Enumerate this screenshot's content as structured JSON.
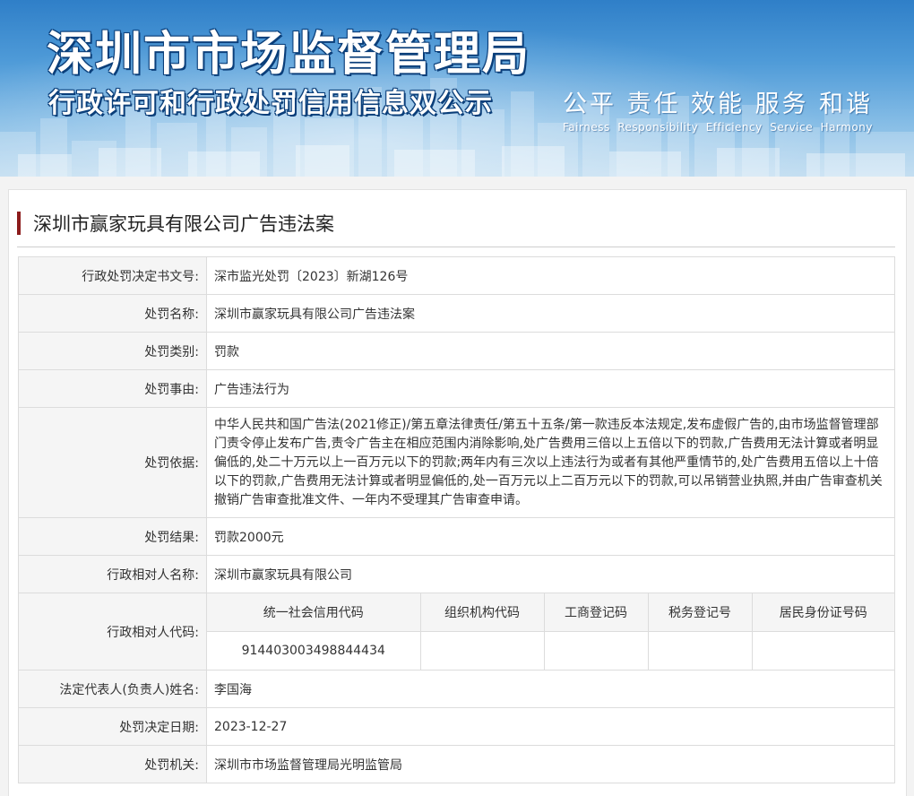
{
  "banner": {
    "title": "深圳市市场监督管理局",
    "subtitle": "行政许可和行政处罚信用信息双公示",
    "slogans_cn": [
      "公平",
      "责任",
      "效能",
      "服务",
      "和谐"
    ],
    "slogans_en": [
      "Fairness",
      "Responsibility",
      "Efficiency",
      "Service",
      "Harmony"
    ]
  },
  "page": {
    "heading": "深圳市赢家玩具有限公司广告违法案"
  },
  "record": {
    "doc_no": {
      "label": "行政处罚决定书文号:",
      "value": "深市监光处罚〔2023〕新湖126号"
    },
    "case_name": {
      "label": "处罚名称:",
      "value": "深圳市赢家玩具有限公司广告违法案"
    },
    "category": {
      "label": "处罚类别:",
      "value": "罚款"
    },
    "cause": {
      "label": "处罚事由:",
      "value": "广告违法行为"
    },
    "basis": {
      "label": "处罚依据:",
      "value": "中华人民共和国广告法(2021修正)/第五章法律责任/第五十五条/第一款违反本法规定,发布虚假广告的,由市场监督管理部门责令停止发布广告,责令广告主在相应范围内消除影响,处广告费用三倍以上五倍以下的罚款,广告费用无法计算或者明显偏低的,处二十万元以上一百万元以下的罚款;两年内有三次以上违法行为或者有其他严重情节的,处广告费用五倍以上十倍以下的罚款,广告费用无法计算或者明显偏低的,处一百万元以上二百万元以下的罚款,可以吊销营业执照,并由广告审查机关撤销广告审查批准文件、一年内不受理其广告审查申请。"
    },
    "result": {
      "label": "处罚结果:",
      "value": "罚款2000元"
    },
    "party_name": {
      "label": "行政相对人名称:",
      "value": "深圳市赢家玩具有限公司"
    },
    "party_code": {
      "label": "行政相对人代码:",
      "headers": [
        "统一社会信用代码",
        "组织机构代码",
        "工商登记码",
        "税务登记号",
        "居民身份证号码"
      ],
      "values": [
        "914403003498844434",
        "",
        "",
        "",
        ""
      ]
    },
    "legal_rep": {
      "label": "法定代表人(负责人)姓名:",
      "value": "李国海"
    },
    "decision_date": {
      "label": "处罚决定日期:",
      "value": "2023-12-27"
    },
    "authority": {
      "label": "处罚机关:",
      "value": "深圳市市场监督管理局光明监管局"
    }
  },
  "colors": {
    "accent_bar": "#8c1c1c",
    "banner_top": "#2f7fc8",
    "label_bg": "#f5f5f5",
    "border": "#dcdcdc"
  }
}
